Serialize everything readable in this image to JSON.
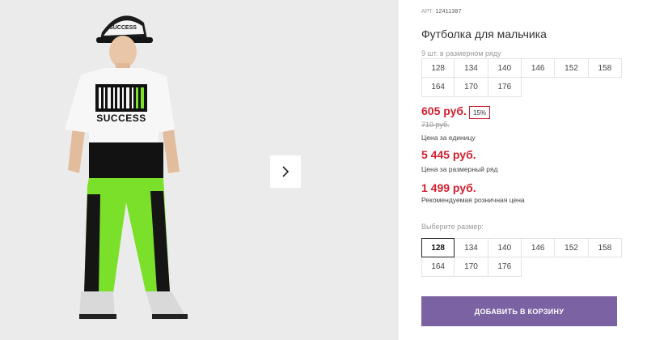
{
  "gallery": {
    "alt": "Мальчик в футболке SUCCESS и зелёных брюках",
    "shirt_text": "SUCCESS",
    "cap_text": "SUCCESS"
  },
  "product": {
    "art_prefix": "АРТ.",
    "art_number": "12411387",
    "title": "Футболка для мальчика",
    "set_note": "9 шт. в размерном ряду",
    "set_sizes": [
      "128",
      "134",
      "140",
      "146",
      "152",
      "158",
      "164",
      "170",
      "176"
    ],
    "price": "605 руб.",
    "discount": "15%",
    "old_price": "710 руб.",
    "price_unit_caption": "Цена за единицу",
    "price_set": "5 445 руб.",
    "price_set_caption": "Цена за размерный ряд",
    "price_rrp": "1 499 руб.",
    "price_rrp_caption": "Рекомендуемая розничная цена",
    "choose_size_label": "Выберите размер:",
    "size_options": [
      "128",
      "134",
      "140",
      "146",
      "152",
      "158",
      "164",
      "170",
      "176"
    ],
    "selected_size": "128",
    "add_to_cart_label": "ДОБАВИТЬ В КОРЗИНУ"
  },
  "colors": {
    "price_red": "#d11f2f",
    "button_purple": "#7b62a3",
    "accent_green": "#7be02a"
  }
}
